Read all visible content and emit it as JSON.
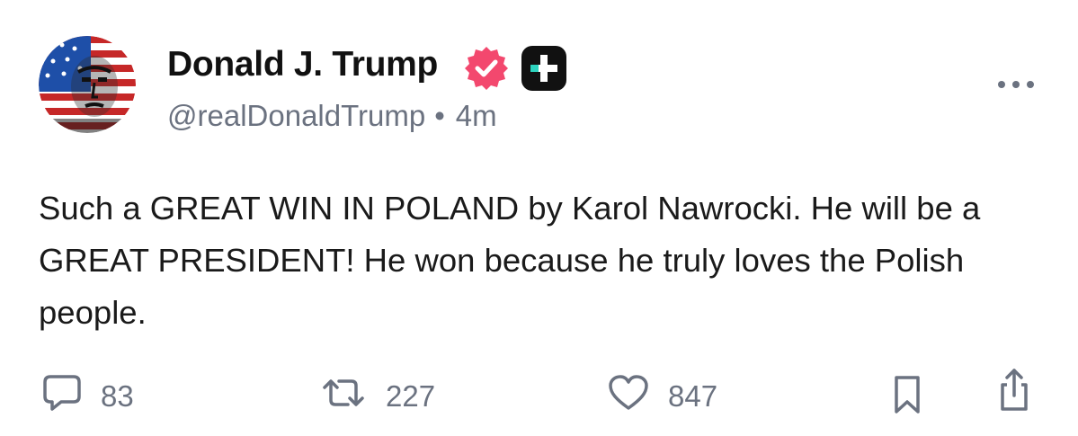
{
  "author": {
    "display_name": "Donald J. Trump",
    "handle": "@realDonaldTrump",
    "separator": "•",
    "time_ago": "4m"
  },
  "post": {
    "text": "Such a GREAT WIN IN POLAND by Karol Nawrocki. He will be a GREAT PRESIDENT! He won because he truly loves the Polish people."
  },
  "actions": {
    "replies": "83",
    "reposts": "227",
    "likes": "847"
  },
  "colors": {
    "verified_badge": "#F3486E",
    "plus_badge": "#111111",
    "plus_badge_accent": "#2DD4BF",
    "muted_text": "#6B7280"
  },
  "icons": [
    "avatar",
    "verified-badge-icon",
    "plus-badge-icon",
    "more-options-icon",
    "reply-icon",
    "repost-icon",
    "like-icon",
    "bookmark-icon",
    "share-icon"
  ]
}
